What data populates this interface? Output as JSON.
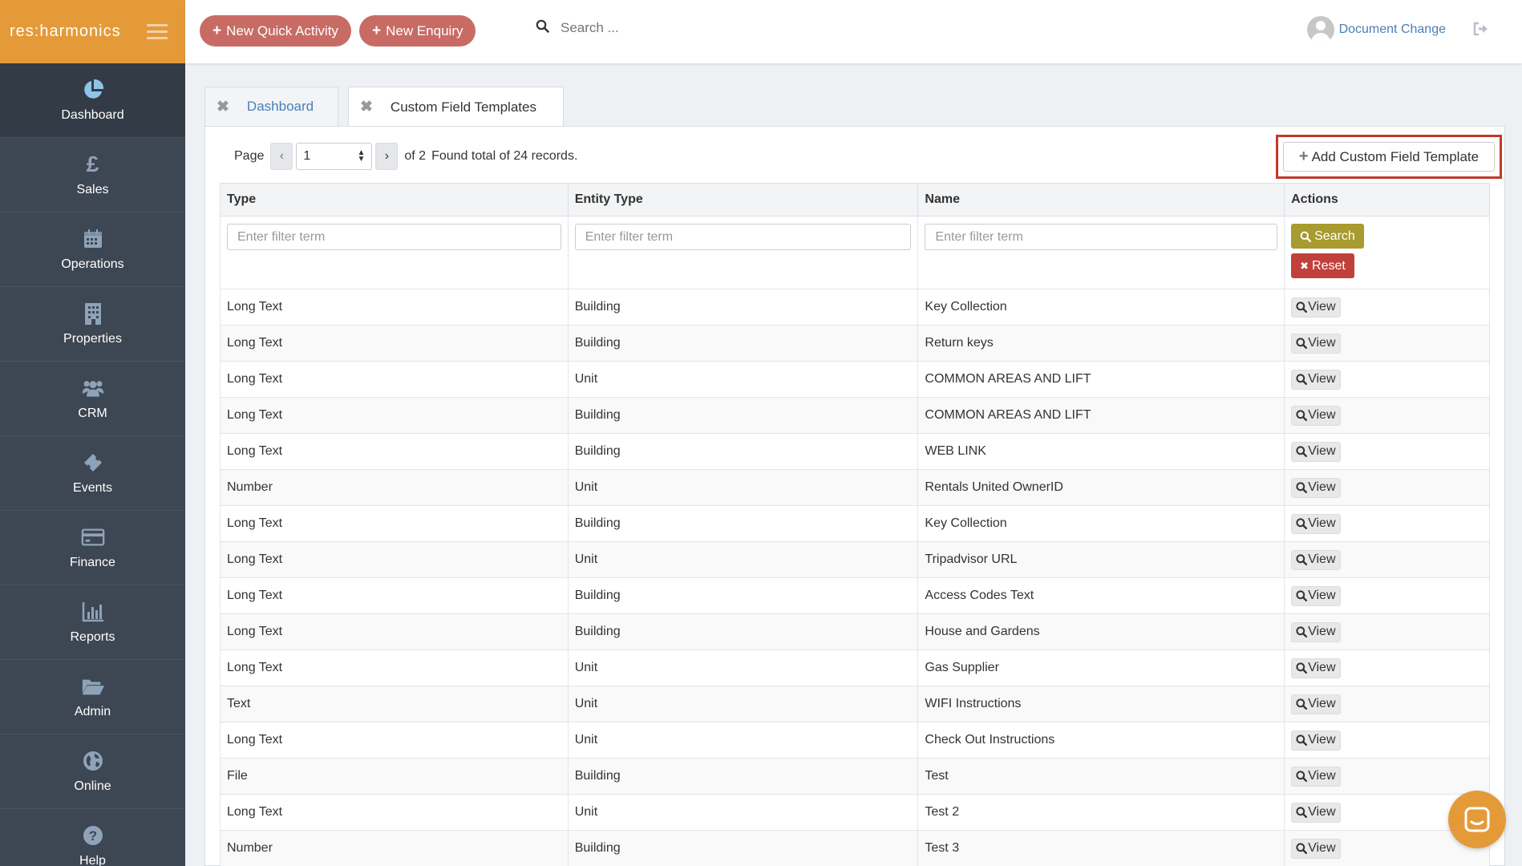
{
  "brand": {
    "name": "res:harmonics"
  },
  "sidebar": {
    "items": [
      {
        "label": "Dashboard",
        "icon": "pie-chart-icon",
        "active": true
      },
      {
        "label": "Sales",
        "icon": "pound-icon"
      },
      {
        "label": "Operations",
        "icon": "calendar-icon"
      },
      {
        "label": "Properties",
        "icon": "building-icon"
      },
      {
        "label": "CRM",
        "icon": "users-icon"
      },
      {
        "label": "Events",
        "icon": "ticket-icon"
      },
      {
        "label": "Finance",
        "icon": "credit-card-icon"
      },
      {
        "label": "Reports",
        "icon": "bar-chart-icon"
      },
      {
        "label": "Admin",
        "icon": "folder-icon"
      },
      {
        "label": "Online",
        "icon": "globe-icon"
      },
      {
        "label": "Help",
        "icon": "question-icon"
      }
    ]
  },
  "topbar": {
    "new_quick_activity": "New Quick Activity",
    "new_enquiry": "New Enquiry",
    "search_placeholder": "Search ...",
    "user_name": "Document Change"
  },
  "tabs": [
    {
      "label": "Dashboard",
      "active": false
    },
    {
      "label": "Custom Field Templates",
      "active": true
    }
  ],
  "pager": {
    "page_label": "Page",
    "current_page": "1",
    "of_label": "of 2",
    "total_label": "Found total of 24 records."
  },
  "add_button": {
    "label": "Add Custom Field Template"
  },
  "table": {
    "columns": [
      "Type",
      "Entity Type",
      "Name",
      "Actions"
    ],
    "filter_placeholder": "Enter filter term",
    "search_label": "Search",
    "reset_label": "Reset",
    "view_label": "View",
    "rows": [
      [
        "Long Text",
        "Building",
        "Key Collection"
      ],
      [
        "Long Text",
        "Building",
        "Return keys"
      ],
      [
        "Long Text",
        "Unit",
        "COMMON AREAS AND LIFT"
      ],
      [
        "Long Text",
        "Building",
        "COMMON AREAS AND LIFT"
      ],
      [
        "Long Text",
        "Building",
        "WEB LINK"
      ],
      [
        "Number",
        "Unit",
        "Rentals United OwnerID"
      ],
      [
        "Long Text",
        "Building",
        "Key Collection"
      ],
      [
        "Long Text",
        "Unit",
        "Tripadvisor URL"
      ],
      [
        "Long Text",
        "Building",
        "Access Codes Text"
      ],
      [
        "Long Text",
        "Building",
        "House and Gardens"
      ],
      [
        "Long Text",
        "Unit",
        "Gas Supplier"
      ],
      [
        "Text",
        "Unit",
        "WIFI Instructions"
      ],
      [
        "Long Text",
        "Unit",
        "Check Out Instructions"
      ],
      [
        "File",
        "Building",
        "Test"
      ],
      [
        "Long Text",
        "Unit",
        "Test 2"
      ],
      [
        "Number",
        "Building",
        "Test 3"
      ]
    ]
  },
  "colors": {
    "brand_orange": "#e59a3a",
    "sidebar_bg": "#3d4653",
    "pill_red": "#c96b65",
    "search_olive": "#a89b2f",
    "reset_red": "#c0413c",
    "highlight_red": "#c0392b",
    "link_blue": "#4a7fb5"
  }
}
